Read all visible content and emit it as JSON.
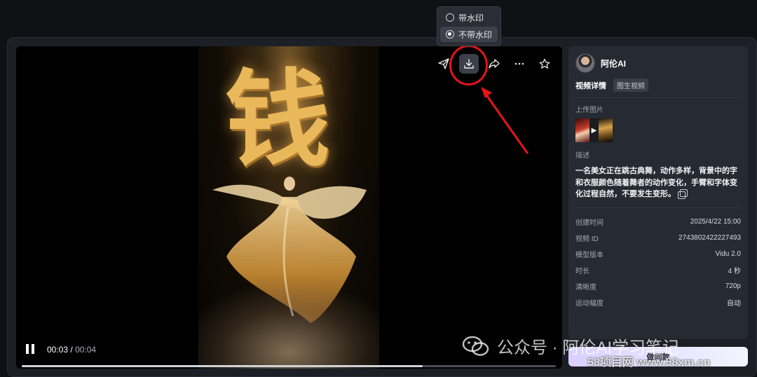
{
  "dropdown": {
    "options": [
      {
        "label": "带水印",
        "selected": false
      },
      {
        "label": "不带水印",
        "selected": true
      }
    ]
  },
  "video": {
    "character": "钱",
    "current_time": "00:03",
    "duration": "00:04",
    "separator": "/",
    "progress": 0.75
  },
  "toolbar": {
    "icons": [
      "send-icon",
      "download-icon",
      "share-icon",
      "more-icon",
      "star-icon"
    ]
  },
  "panel": {
    "username": "阿伦AI",
    "tab_active": "视频详情",
    "tag": "图生视频",
    "upload_label": "上传图片",
    "desc_label": "描述",
    "description": "一名美女正在跳古典舞，动作多样，背景中的字和衣服颜色随着舞者的动作变化，手臂和字体变化过程自然，不要发生变形。",
    "info": [
      {
        "k": "创建时间",
        "v": "2025/4/22 15:00"
      },
      {
        "k": "视频 ID",
        "v": "2743802422227493"
      },
      {
        "k": "模型版本",
        "v": "Vidu 2.0"
      },
      {
        "k": "时长",
        "v": "4 秒"
      },
      {
        "k": "清晰度",
        "v": "720p"
      },
      {
        "k": "运动幅度",
        "v": "自动"
      }
    ],
    "ask_button": "做同款"
  },
  "watermarks": {
    "wechat": "公众号 · 阿伦AI学习笔记",
    "site": "58项目网 www.58xm.cn"
  },
  "colors": {
    "highlight": "#e5141a",
    "panel_bg": "#262a32",
    "accent_gold": "#e9b85a"
  }
}
